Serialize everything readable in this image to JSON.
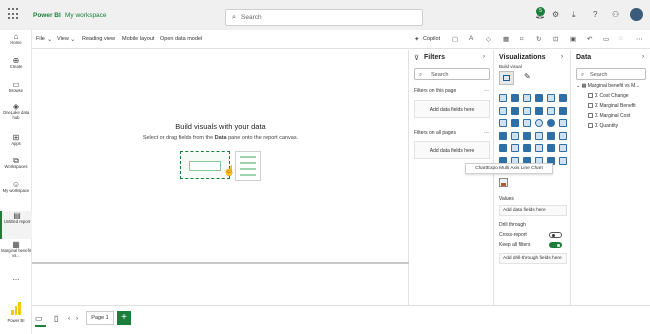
{
  "topbar": {
    "app_name": "Power BI",
    "workspace": "My workspace",
    "search_placeholder": "Search",
    "notification_count": "5"
  },
  "leftnav": {
    "items": [
      {
        "label": "Home",
        "icon": "home-icon"
      },
      {
        "label": "Create",
        "icon": "plus-circle-icon"
      },
      {
        "label": "Browse",
        "icon": "folder-icon"
      },
      {
        "label": "OneLake data hub",
        "icon": "onelake-icon"
      },
      {
        "label": "Apps",
        "icon": "apps-icon"
      },
      {
        "label": "Workspaces",
        "icon": "workspaces-icon"
      },
      {
        "label": "My workspace",
        "icon": "my-workspace-icon"
      },
      {
        "label": "Untitled report",
        "icon": "report-icon"
      },
      {
        "label": "Marginal benefit vs...",
        "icon": "dataset-icon"
      }
    ],
    "more": "...",
    "footer_label": "Power BI"
  },
  "ribbon": {
    "file": "File",
    "view": "View",
    "reading_view": "Reading view",
    "mobile_layout": "Mobile layout",
    "open_data_model": "Open data model",
    "copilot": "Copilot"
  },
  "canvas": {
    "title": "Build visuals with your data",
    "subtitle_pre": "Select or drag fields from the ",
    "subtitle_bold": "Data",
    "subtitle_post": " pane onto the report canvas."
  },
  "filters": {
    "title": "Filters",
    "search_placeholder": "Search",
    "on_this_page": "Filters on this page",
    "on_all_pages": "Filters on all pages",
    "add_data_fields": "Add data fields here"
  },
  "visualizations": {
    "title": "Visualizations",
    "build_visual": "Build visual",
    "tooltip": "ChartExpo Multi Axis Line Chart",
    "values_label": "Values",
    "values_placeholder": "Add data fields here",
    "drill_through": "Drill through",
    "cross_report": "Cross-report",
    "cross_report_state": "Off",
    "keep_all_filters": "Keep all filters",
    "keep_all_filters_state": "On",
    "drill_placeholder": "Add drill-through fields here"
  },
  "data_pane": {
    "title": "Data",
    "search_placeholder": "Search",
    "table": "Marginal benefit vs M...",
    "fields": [
      "Cost Change",
      "Marginal Benefit",
      "Marginal Cost",
      "Quantity"
    ]
  },
  "bottombar": {
    "page_tab": "Page 1",
    "add_page": "+"
  },
  "colors": {
    "accent": "#1b7f3b",
    "visual_icon": "#2f6fa8",
    "logo": "#f2c811"
  }
}
